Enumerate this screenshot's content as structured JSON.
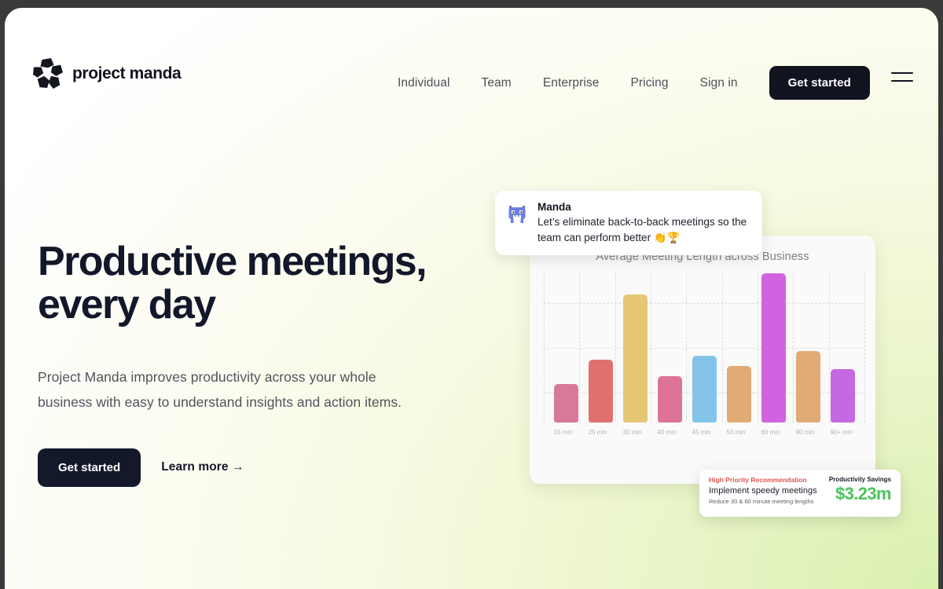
{
  "brand": {
    "name": "project manda",
    "logo_icon": "manda-logo-icon"
  },
  "nav": {
    "links": [
      {
        "label": "Individual",
        "name": "nav-link-individual"
      },
      {
        "label": "Team",
        "name": "nav-link-team"
      },
      {
        "label": "Enterprise",
        "name": "nav-link-enterprise"
      },
      {
        "label": "Pricing",
        "name": "nav-link-pricing"
      },
      {
        "label": "Sign in",
        "name": "nav-link-sign-in"
      }
    ],
    "cta_label": "Get started",
    "menu_icon": "hamburger-menu-icon"
  },
  "hero": {
    "title_line1": "Productive meetings,",
    "title_line2": "every day",
    "subtitle": "Project Manda improves productivity across your whole business with easy to understand insights and action items.",
    "primary_cta": "Get started",
    "secondary_cta": "Learn more →"
  },
  "chat": {
    "avatar_icon": "manda-monster-avatar",
    "sender": "Manda",
    "message": "Let’s eliminate back-to-back meetings so the team can perform better 👏🏆"
  },
  "recommendation": {
    "tag": "High Priority Recommendation",
    "title": "Implement speedy meetings",
    "subtitle": "Reduce 30 & 60 minute meeting lengths",
    "savings_label": "Productivity Savings",
    "savings_value": "$3.23m"
  },
  "colors": {
    "accent_dark": "#14182b",
    "page_green": "#d9f0ae",
    "savings_green": "#4cc35c",
    "priority_red": "#e0564f"
  },
  "chart_data": {
    "type": "bar",
    "title": "Average Meeting Length across Business",
    "xlabel": "",
    "ylabel": "",
    "ylim": [
      0,
      100
    ],
    "grid": true,
    "legend": "none",
    "categories": [
      "15 min",
      "25 min",
      "30 min",
      "40 min",
      "45 min",
      "50 min",
      "60 min",
      "90 min",
      "90+ min"
    ],
    "values": [
      26,
      42,
      86,
      31,
      45,
      38,
      100,
      48,
      36
    ],
    "colors": [
      "#d7799a",
      "#e0716e",
      "#e5c773",
      "#dd7496",
      "#83c5e9",
      "#e0ab74",
      "#d263e0",
      "#e0ab74",
      "#c569e0"
    ]
  }
}
